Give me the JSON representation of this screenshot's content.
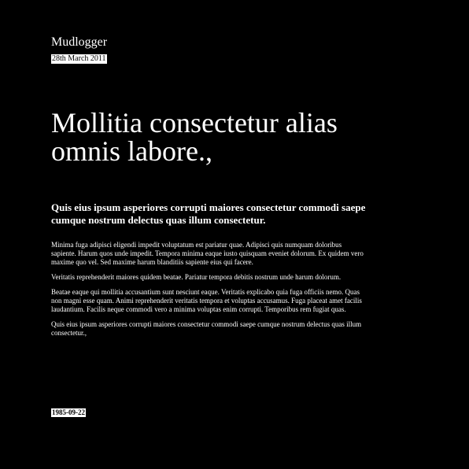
{
  "header": {
    "site_title": "Mudlogger",
    "date": "28th March 2011"
  },
  "article": {
    "headline": "Mollitia consectetur alias omnis labore.,",
    "lede": "Quis eius ipsum asperiores corrupti maiores consectetur commodi saepe cumque nostrum delectus quas illum consectetur.",
    "paragraphs": [
      "Minima fuga adipisci eligendi impedit voluptatum est pariatur quae. Adipisci quis numquam doloribus sapiente. Harum quos unde impedit. Tempora minima eaque iusto quisquam eveniet dolorum. Ex quidem vero maxime quo vel. Sed maxime harum blanditiis sapiente eius qui facere.",
      "Veritatis reprehenderit maiores quidem beatae. Pariatur tempora debitis nostrum unde harum dolorum.",
      "Beatae eaque qui mollitia accusantium sunt nesciunt eaque. Veritatis explicabo quia fuga officiis nemo. Quas non magni esse quam. Animi reprehenderit veritatis tempora et voluptas accusamus. Fuga placeat amet facilis laudantium. Facilis neque commodi vero a minima voluptas enim corrupti. Temporibus rem fugiat quas.",
      "Quis eius ipsum asperiores corrupti maiores consectetur commodi saepe cumque nostrum delectus quas illum consectetur.,"
    ]
  },
  "footer": {
    "date": "1985-09-22"
  },
  "colors": {
    "background": "#000000",
    "text": "#ffffff"
  }
}
